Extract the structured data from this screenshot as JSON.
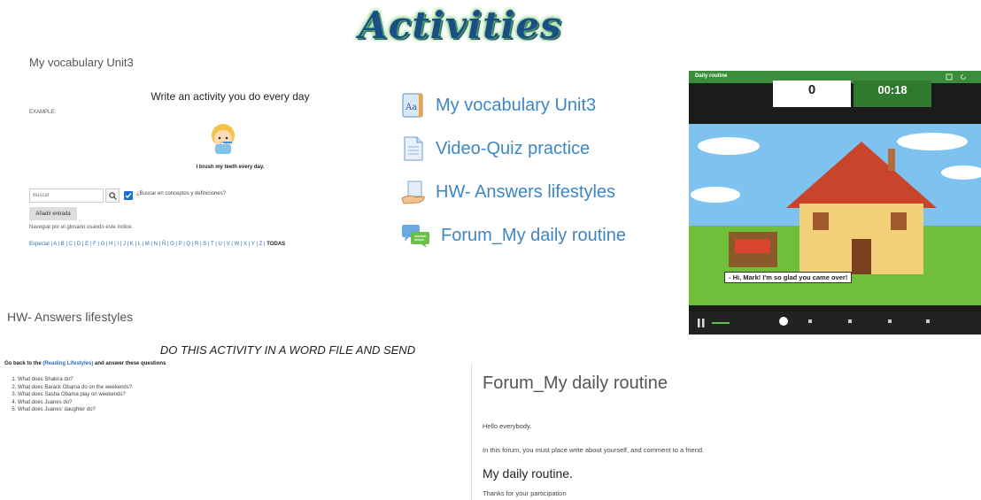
{
  "header": {
    "title": "Activities"
  },
  "vocab": {
    "heading": "My vocabulary Unit3",
    "prompt": "Write an activity you do every day",
    "example_label": "EXAMPLE:",
    "sentence": "I brush my teeth every day.",
    "search_placeholder": "Buscar",
    "concept_label": "¿Buscar en conceptos y definiciones?",
    "add_button": "Añadir entrada",
    "browse_hint": "Navegue por el glosario usando este índice.",
    "alphabet": "Especial | A | B | C | D | E | F | G | H | I | J | K | L | M | N | Ñ | O | P | Q | R | S | T | U | V | W | X | Y | Z |",
    "alphabet_all": "TODAS"
  },
  "activities": [
    {
      "label": "My vocabulary Unit3",
      "icon": "dictionary-icon"
    },
    {
      "label": "Video-Quiz practice",
      "icon": "document-icon"
    },
    {
      "label": "HW- Answers lifestyles",
      "icon": "hand-paper-icon"
    },
    {
      "label": "Forum_My daily routine",
      "icon": "forum-chat-icon"
    }
  ],
  "video": {
    "title": "Daily routine",
    "score": "0",
    "timer": "00:18",
    "caption": "- Hi, Mark! I'm so glad you came over!"
  },
  "hw": {
    "heading": "HW- Answers lifestyles",
    "instruction": "DO THIS ACTIVITY IN A WORD FILE AND SEND",
    "intro_pre": "Go back to the",
    "intro_link": "(Reading Lifestyles)",
    "intro_post": "and answer these questions",
    "questions": [
      "What does Shakira do?",
      "What does Barack Obama do on the weekends?",
      "What does  Sasha Obama play on weekends?",
      "What does Juanes do?",
      "What does Juanes' daughter do?"
    ]
  },
  "forum": {
    "heading": "Forum_My daily routine",
    "greeting": "Hello everybody.",
    "body": "In this forum, you must place write about yourself, and comment to a friend.",
    "routine": "My daily routine.",
    "thanks": "Thanks for your participation"
  },
  "colors": {
    "link": "#3d86c6",
    "video_green": "#3a8d3a",
    "title_blue": "#1a4f86"
  }
}
